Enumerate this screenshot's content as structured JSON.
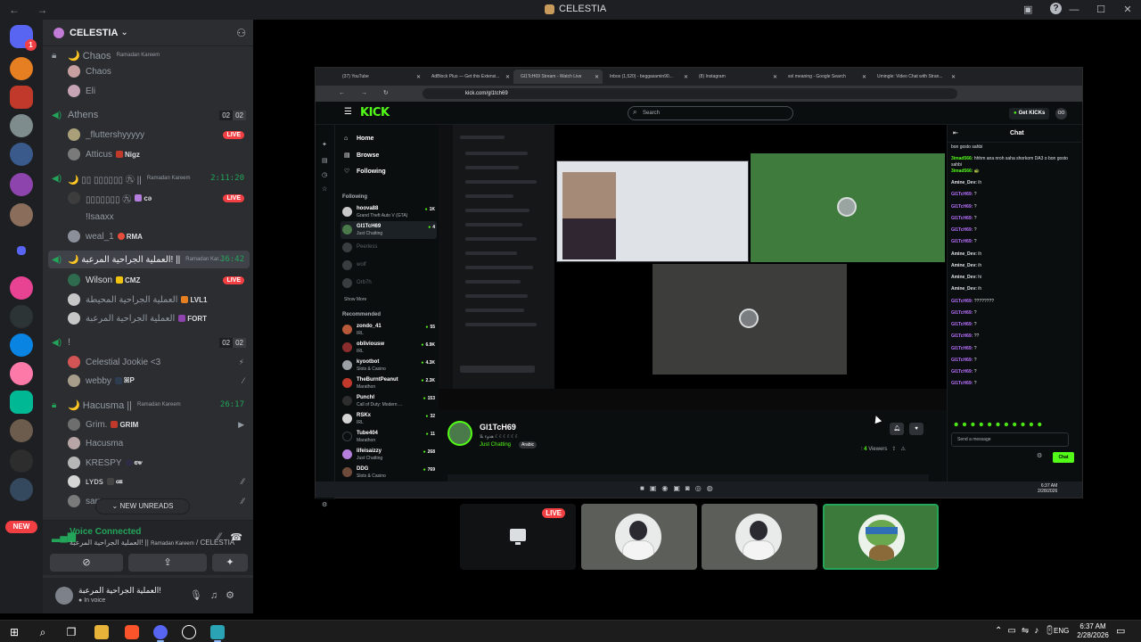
{
  "window": {
    "title": "CELESTIA"
  },
  "server": {
    "name": "CELESTIA"
  },
  "voice_channels": [
    {
      "name": "🌙 Chaos",
      "tag": "Ramadan Kareem",
      "members": [
        {
          "name": "Chaos"
        },
        {
          "name": "Eli"
        }
      ]
    },
    {
      "name": "Athens",
      "counts": [
        "02",
        "02"
      ],
      "members": [
        {
          "name": "_fluttershyyyyy",
          "live": "LIVE"
        },
        {
          "name": "Atticus",
          "tag": "Nigz"
        }
      ]
    },
    {
      "name": "🌙 ▯▯ ▯▯▯▯▯▯ ㊈ ||",
      "tag": "Ramadan Kareem",
      "time": "2:11:20",
      "members": [
        {
          "name": "▯▯▯▯▯▯▯ ㊈",
          "tag": "cə",
          "live": "LIVE"
        },
        {
          "name": "!Isaaxx"
        },
        {
          "name": "weal_1",
          "tag": "RMA"
        }
      ]
    },
    {
      "name": "🌙 العملية الجراحية المرعبة! ||",
      "tag": "Ramadan Kar...",
      "time": "36:42",
      "active": true,
      "members": [
        {
          "name": "Wilson",
          "tag": "CMZ",
          "live": "LIVE"
        },
        {
          "name": "العملية الجراحية المحيطة",
          "tag": "LVL1"
        },
        {
          "name": "العملية الجراحية المرعبة",
          "tag": "FORT"
        }
      ]
    },
    {
      "name": "!",
      "counts": [
        "02",
        "02"
      ],
      "members": [
        {
          "name": "Celestial Jookie <3"
        },
        {
          "name": "webby",
          "tag": "ꕤP"
        }
      ]
    },
    {
      "name": "🌙 Hacusma ||",
      "tag": "Ramadan Kareem",
      "time": "26:17",
      "members": [
        {
          "name": "Grim.",
          "tag": "GRIM"
        },
        {
          "name": "Hacusma"
        },
        {
          "name": "KRESPY",
          "tag": "ꮆꮤ"
        },
        {
          "name": "ʟʏᴅꜱ",
          "tag": "ꮐꭼ"
        },
        {
          "name": "sarra_"
        }
      ]
    }
  ],
  "new_unreads": "NEW UNREADS",
  "new_badge": "NEW",
  "discord_badge": "1",
  "voice_panel": {
    "status": "Voice Connected",
    "location_channel": "العملية الجراحية المرعبة! ||",
    "location_tag": "Ramadan Kareem",
    "location_server": "/ CELESTIA"
  },
  "user_panel": {
    "name": "العملية الجراحية المرعبة!",
    "status": "In voice"
  },
  "browser": {
    "tabs": [
      "(37) YouTube",
      "AdBlock Plus — Get this Extensi...",
      "Gl1TcH69 Stream - Watch Live",
      "Inbox (1,520) - beggasamin90...",
      "(8) Instagram",
      "sol meaning - Google Search",
      "Umingle: Video Chat with Stran..."
    ],
    "url": "kick.com/gl1tch69"
  },
  "kick": {
    "logo": "KICK",
    "search_placeholder": "Search",
    "get_kicks": "Get KICKs",
    "user_initials": "OO",
    "nav": [
      {
        "label": "Home",
        "icon": "⌂"
      },
      {
        "label": "Browse",
        "icon": "▤"
      },
      {
        "label": "Following",
        "icon": "♡"
      }
    ],
    "following_heading": "Following",
    "following": [
      {
        "name": "hoova88",
        "category": "Grand Theft Auto V (GTA)",
        "viewers": "1K"
      },
      {
        "name": "Gl1TcH69",
        "category": "Just Chatting",
        "viewers": "4",
        "selected": true
      },
      {
        "name": "Peerless",
        "offline": true
      },
      {
        "name": "wolf",
        "offline": true
      },
      {
        "name": "Orb7h",
        "offline": true
      }
    ],
    "show_more": "Show More",
    "recommended_heading": "Recommended",
    "recommended": [
      {
        "name": "zondo_41",
        "category": "IRL",
        "viewers": "55"
      },
      {
        "name": "obliviousw",
        "category": "IRL",
        "viewers": "6.9K"
      },
      {
        "name": "kyootbot",
        "category": "Slots & Casino",
        "viewers": "4.3K"
      },
      {
        "name": "TheBurntPeanut",
        "category": "Marathon",
        "viewers": "2.3K"
      },
      {
        "name": "PunchI",
        "category": "Call of Duty: Modern ...",
        "viewers": "153"
      },
      {
        "name": "RSKx",
        "category": "IRL",
        "viewers": "32"
      },
      {
        "name": "Tube404",
        "category": "Marathon",
        "viewers": "11"
      },
      {
        "name": "lifeisaizzy",
        "category": "Just Chatting",
        "viewers": "268"
      },
      {
        "name": "DDG",
        "category": "Slots & Casino",
        "viewers": "769"
      }
    ],
    "streamer": {
      "name": "Gl1TcH69",
      "title": "هدوء بلا ☾☾☾☾☾☾",
      "category": "Just Chatting",
      "tag": "Arabic",
      "viewers_count": "4",
      "viewers_label": "Viewers"
    },
    "chat": {
      "title": "Chat",
      "messages": [
        {
          "user": "",
          "text": "bon gosto sahbi",
          "color": "white"
        },
        {
          "user": "3imad566:",
          "text": "hhhm ana nroh saha shorkom DA3 o bon gosto sahbi",
          "color": "green"
        },
        {
          "user": "3imad566:",
          "text": "🐢",
          "color": "green"
        },
        {
          "user": "Amine_Dev:",
          "text": "ih",
          "color": "white"
        },
        {
          "user": "Gl1TcH69:",
          "text": "?",
          "color": "purple"
        },
        {
          "user": "Gl1TcH69:",
          "text": "?",
          "color": "purple"
        },
        {
          "user": "Gl1TcH69:",
          "text": "?",
          "color": "purple"
        },
        {
          "user": "Gl1TcH69:",
          "text": "?",
          "color": "purple"
        },
        {
          "user": "Gl1TcH69:",
          "text": "?",
          "color": "purple"
        },
        {
          "user": "Amine_Dev:",
          "text": "ih",
          "color": "white"
        },
        {
          "user": "Amine_Dev:",
          "text": "ih",
          "color": "white"
        },
        {
          "user": "Amine_Dev:",
          "text": "hi",
          "color": "white"
        },
        {
          "user": "Amine_Dev:",
          "text": "ih",
          "color": "white"
        },
        {
          "user": "Gl1TcH69:",
          "text": "????????",
          "color": "purple"
        },
        {
          "user": "Gl1TcH69:",
          "text": "?",
          "color": "purple"
        },
        {
          "user": "Gl1TcH69:",
          "text": "?",
          "color": "purple"
        },
        {
          "user": "Gl1TcH69:",
          "text": "??",
          "color": "purple"
        },
        {
          "user": "Gl1TcH69:",
          "text": "?",
          "color": "purple"
        },
        {
          "user": "Gl1TcH69:",
          "text": "?",
          "color": "purple"
        },
        {
          "user": "Gl1TcH69:",
          "text": "?",
          "color": "purple"
        },
        {
          "user": "Gl1TcH69:",
          "text": "?",
          "color": "purple"
        }
      ],
      "input_placeholder": "Send a message",
      "send_label": "Chat"
    },
    "inner_clock": {
      "time": "6:37 AM",
      "date": "2/28/2026"
    }
  },
  "call": {
    "live_badge": "LIVE"
  },
  "taskbar": {
    "lang": "ENG",
    "time": "6:37 AM",
    "date": "2/28/2026"
  },
  "colors": {
    "kick_green": "#53fc18",
    "discord_green": "#23a55a",
    "live_red": "#f23f43",
    "blurple": "#5865f2"
  }
}
